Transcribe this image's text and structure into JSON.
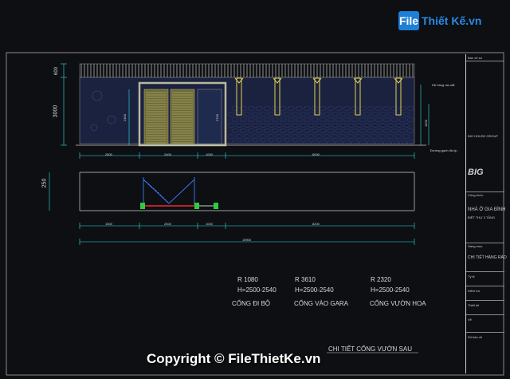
{
  "watermark": {
    "logo_badge": "File",
    "logo_text": "Thiết Kế.vn",
    "copyright": "Copyright © FileThietKe.vn"
  },
  "elevation_dims": {
    "height_top": "600",
    "height_main": "3000",
    "height_gate": "2300",
    "height_post": "2700",
    "height_right": "1600",
    "note_top": "Hệ hàng rào sắt",
    "note_bottom": "Đường gạch đá ốp",
    "segments": [
      "2800",
      "2400",
      "1000",
      "8000"
    ]
  },
  "plan_dims": {
    "width_left": "250",
    "segments": [
      "1500",
      "2400",
      "1000",
      "8200"
    ],
    "total": "15900"
  },
  "gate_schedule": [
    {
      "radius": "R 1080",
      "height": "H=2500-2540",
      "name": "CỔNG ĐI BỘ"
    },
    {
      "radius": "R 3610",
      "height": "H=2500-2540",
      "name": "CỔNG VÀO GARA"
    },
    {
      "radius": "R 2320",
      "height": "H=2500-2540",
      "name": "CỔNG VƯỜN HOA"
    }
  ],
  "drawing_title": "CHI TIẾT CỔNG VƯỜN SAU",
  "title_block": {
    "rows": [
      "Bản vẽ số",
      "BIG HOUSE GROUP",
      "Công trình:",
      "NHÀ Ở GIA ĐÌNH",
      "BIỆT THỰ 3 TẦNG",
      "Hạng mục:",
      "CHI TIẾT HÀNG RÀO",
      "Tỷ lệ",
      "Kiểm tra",
      "Thiết kế",
      "Vẽ",
      "Số bản vẽ"
    ],
    "brand": "BIG"
  },
  "colors": {
    "background": "#0d0f12",
    "wall_fill": "#1b2240",
    "gate_fill": "#6e6a36",
    "gate_frame": "#b9b79a",
    "dim_line": "#2ee2ee",
    "text": "#d9d9d9",
    "watermark": "#1e7fd6"
  }
}
